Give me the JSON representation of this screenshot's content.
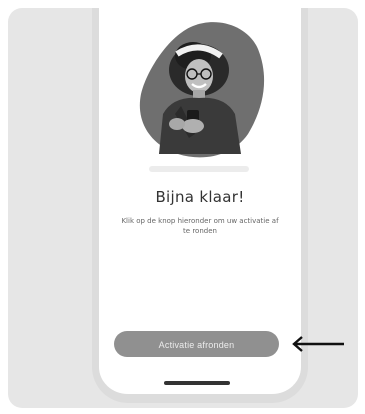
{
  "screen": {
    "title": "Bijna klaar!",
    "subtitle": "Klik op de knop hieronder om uw activatie af te ronden",
    "primary_button_label": "Activatie afronden"
  },
  "icons": {
    "hero": "woman-holding-phone-illustration",
    "pointer": "arrow-left-icon",
    "home": "home-indicator"
  }
}
